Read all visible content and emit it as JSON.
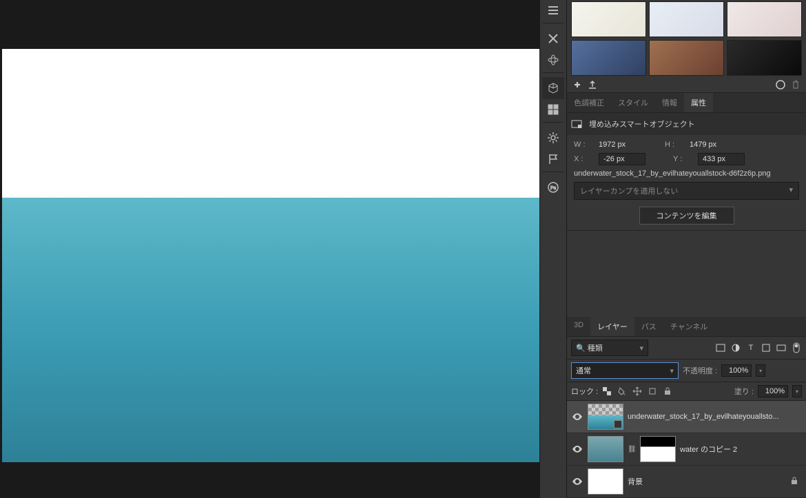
{
  "panel_tabs": {
    "adjustments": "色調補正",
    "styles": "スタイル",
    "info": "情報",
    "properties": "属性"
  },
  "properties": {
    "header": "埋め込みスマートオブジェクト",
    "w_label": "W :",
    "w_value": "1972 px",
    "h_label": "H :",
    "h_value": "1479 px",
    "x_label": "X :",
    "x_value": "-26 px",
    "y_label": "Y :",
    "y_value": "433 px",
    "filename": "underwater_stock_17_by_evilhateyouallstock-d6f2z6p.png",
    "layercomp_placeholder": "レイヤーカンプを適用しない",
    "edit_button": "コンテンツを編集"
  },
  "layers_tabs": {
    "threeD": "3D",
    "layers": "レイヤー",
    "paths": "パス",
    "channels": "チャンネル"
  },
  "layers_panel": {
    "filter_label": "種類",
    "blend_mode": "通常",
    "opacity_label": "不透明度 :",
    "opacity_value": "100%",
    "lock_label": "ロック :",
    "fill_label": "塗り :",
    "fill_value": "100%",
    "layers": [
      {
        "name": "underwater_stock_17_by_evilhateyouallsto...",
        "selected": true
      },
      {
        "name": "water のコピー 2",
        "selected": false
      },
      {
        "name": "背景",
        "selected": false,
        "locked": true
      }
    ]
  }
}
